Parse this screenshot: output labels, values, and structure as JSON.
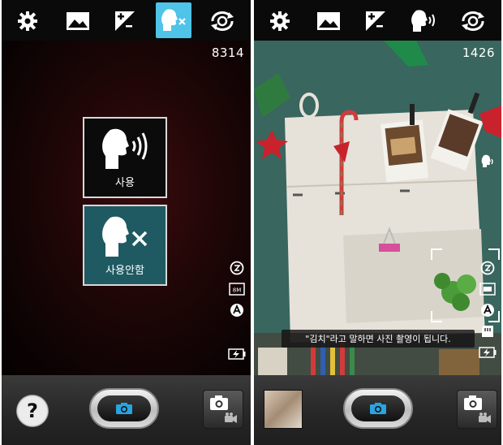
{
  "left_screen": {
    "shot_counter": "8314",
    "voice_options": {
      "use_label": "사용",
      "off_label": "사용안함"
    },
    "toolbar_icons": [
      "gear-icon",
      "gallery-icon",
      "exposure-icon",
      "voice-off-icon",
      "switch-camera-icon"
    ],
    "side_status_icons": [
      "timer-icon",
      "resolution-8m-icon",
      "auto-mode-icon",
      "battery-charging-icon"
    ],
    "resolution_badge": "8M",
    "help_label": "?"
  },
  "right_screen": {
    "shot_counter": "1426",
    "toast_message": "\"김치\"라고 말하면 사진 촬영이 됩니다.",
    "toolbar_icons": [
      "gear-icon",
      "gallery-icon",
      "exposure-icon",
      "voice-on-icon",
      "switch-camera-icon"
    ],
    "side_status_icons": [
      "voice-indicator-icon",
      "timer-icon",
      "resolution-icon",
      "auto-mode-icon",
      "storage-icon",
      "battery-charging-icon"
    ]
  },
  "colors": {
    "active_tab": "#4fc3e8",
    "selected_option": "#1f5a62",
    "shutter_icon": "#2aa3e0"
  }
}
